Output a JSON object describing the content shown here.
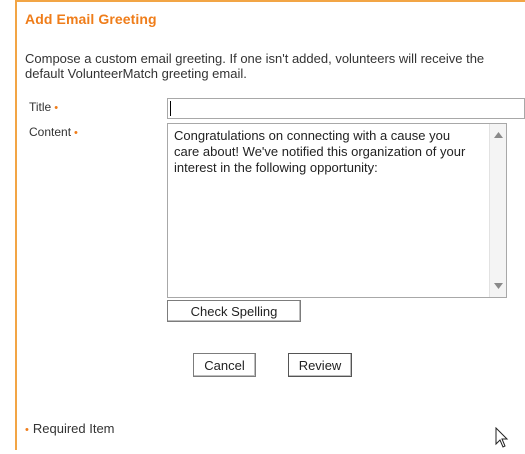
{
  "header": {
    "title": "Add Email Greeting"
  },
  "intro": {
    "text": "Compose a custom email greeting. If one isn't added, volunteers will receive the default VolunteerMatch greeting email."
  },
  "form": {
    "title_field": {
      "label": "Title",
      "required_marker": "•",
      "value": ""
    },
    "content_field": {
      "label": "Content",
      "required_marker": "•",
      "value": "Congratulations on connecting with a cause you care about! We've notified this organization of your interest in the following opportunity:"
    }
  },
  "buttons": {
    "check_spelling": "Check Spelling",
    "cancel": "Cancel",
    "review": "Review"
  },
  "footer": {
    "required_marker": "•",
    "required_label": "Required Item"
  },
  "icons": {
    "scroll_up": "scroll-up-arrow-icon",
    "scroll_down": "scroll-down-arrow-icon",
    "cursor": "mouse-pointer-icon"
  },
  "colors": {
    "accent": "#ef7d1a",
    "border_accent": "#f2a545",
    "text": "#333333"
  }
}
